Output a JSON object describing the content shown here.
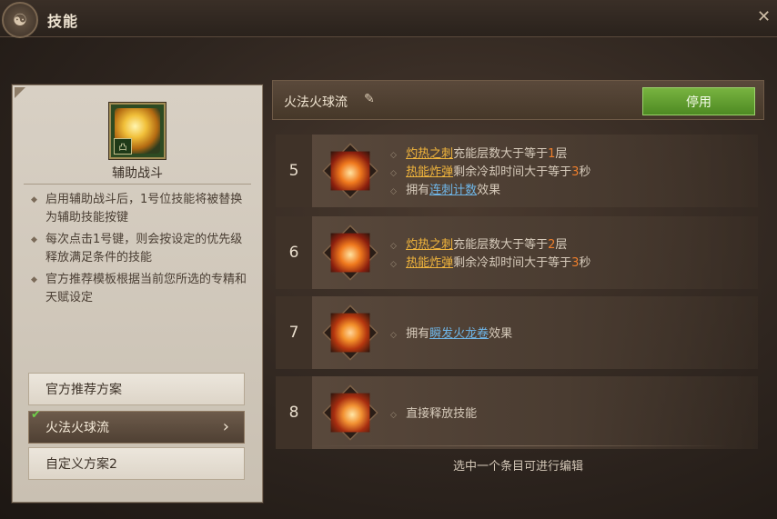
{
  "window": {
    "title": "技能",
    "close_glyph": "✕"
  },
  "left_panel": {
    "skill_name": "辅助战斗",
    "skill_tag": "凸",
    "description": [
      "启用辅助战斗后，1号位技能将被替换为辅助技能按键",
      "每次点击1号键，则会按设定的优先级释放满足条件的技能",
      "官方推荐模板根据当前您所选的专精和天赋设定"
    ],
    "plans": [
      {
        "label": "官方推荐方案",
        "active": false
      },
      {
        "label": "火法火球流",
        "active": true
      },
      {
        "label": "自定义方案2",
        "active": false
      }
    ]
  },
  "right_panel": {
    "plan_title": "火法火球流",
    "disable_label": "停用",
    "footer_hint": "选中一个条目可进行编辑",
    "rows": [
      {
        "num": "5",
        "conds": [
          {
            "a": "灼热之刺",
            "b": "充能层数大于等于",
            "c": "1",
            "d": "层",
            "t": "o"
          },
          {
            "a": "热能炸弹",
            "b": "剩余冷却时间大于等于",
            "c": "3",
            "d": "秒",
            "t": "o"
          },
          {
            "a": "连刺计数",
            "pre": "拥有",
            "b": "效果",
            "t": "b"
          }
        ]
      },
      {
        "num": "6",
        "conds": [
          {
            "a": "灼热之刺",
            "b": "充能层数大于等于",
            "c": "2",
            "d": "层",
            "t": "o"
          },
          {
            "a": "热能炸弹",
            "b": "剩余冷却时间大于等于",
            "c": "3",
            "d": "秒",
            "t": "o"
          }
        ]
      },
      {
        "num": "7",
        "conds": [
          {
            "a": "瞬发火龙卷",
            "pre": "拥有",
            "b": "效果",
            "t": "b"
          }
        ]
      },
      {
        "num": "8",
        "conds": [
          {
            "plain": "直接释放技能"
          }
        ]
      }
    ]
  },
  "colors": {
    "accent_green": "#5f9a2e",
    "highlight_orange": "#f0b43c",
    "highlight_blue": "#6fb6e8"
  }
}
